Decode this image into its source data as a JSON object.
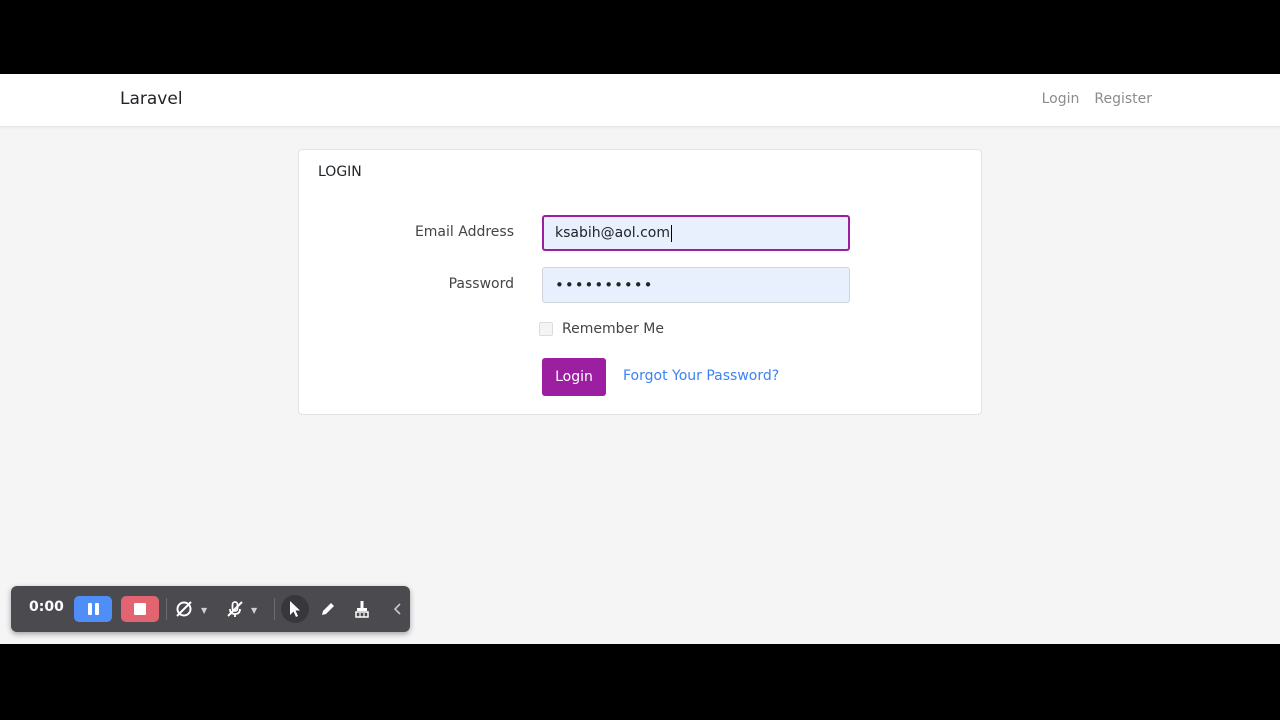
{
  "navbar": {
    "brand": "Laravel",
    "links": [
      {
        "label": "Login"
      },
      {
        "label": "Register"
      }
    ]
  },
  "card": {
    "header": "LOGIN",
    "email": {
      "label": "Email Address",
      "value": "ksabih@aol.com"
    },
    "password": {
      "label": "Password",
      "value": "••••••••••"
    },
    "remember": {
      "label": "Remember Me",
      "checked": false
    },
    "submit_label": "Login",
    "forgot_label": "Forgot Your Password?"
  },
  "recorder": {
    "time": "0:00",
    "icons": [
      "pause-icon",
      "stop-icon",
      "camera-off-icon",
      "mic-off-icon",
      "pointer-icon",
      "pen-icon",
      "eraser-icon",
      "chevron-left-icon"
    ]
  },
  "colors": {
    "accent": "#9b1fa0",
    "link": "#3b82f6",
    "page_bg": "#f5f5f6"
  }
}
